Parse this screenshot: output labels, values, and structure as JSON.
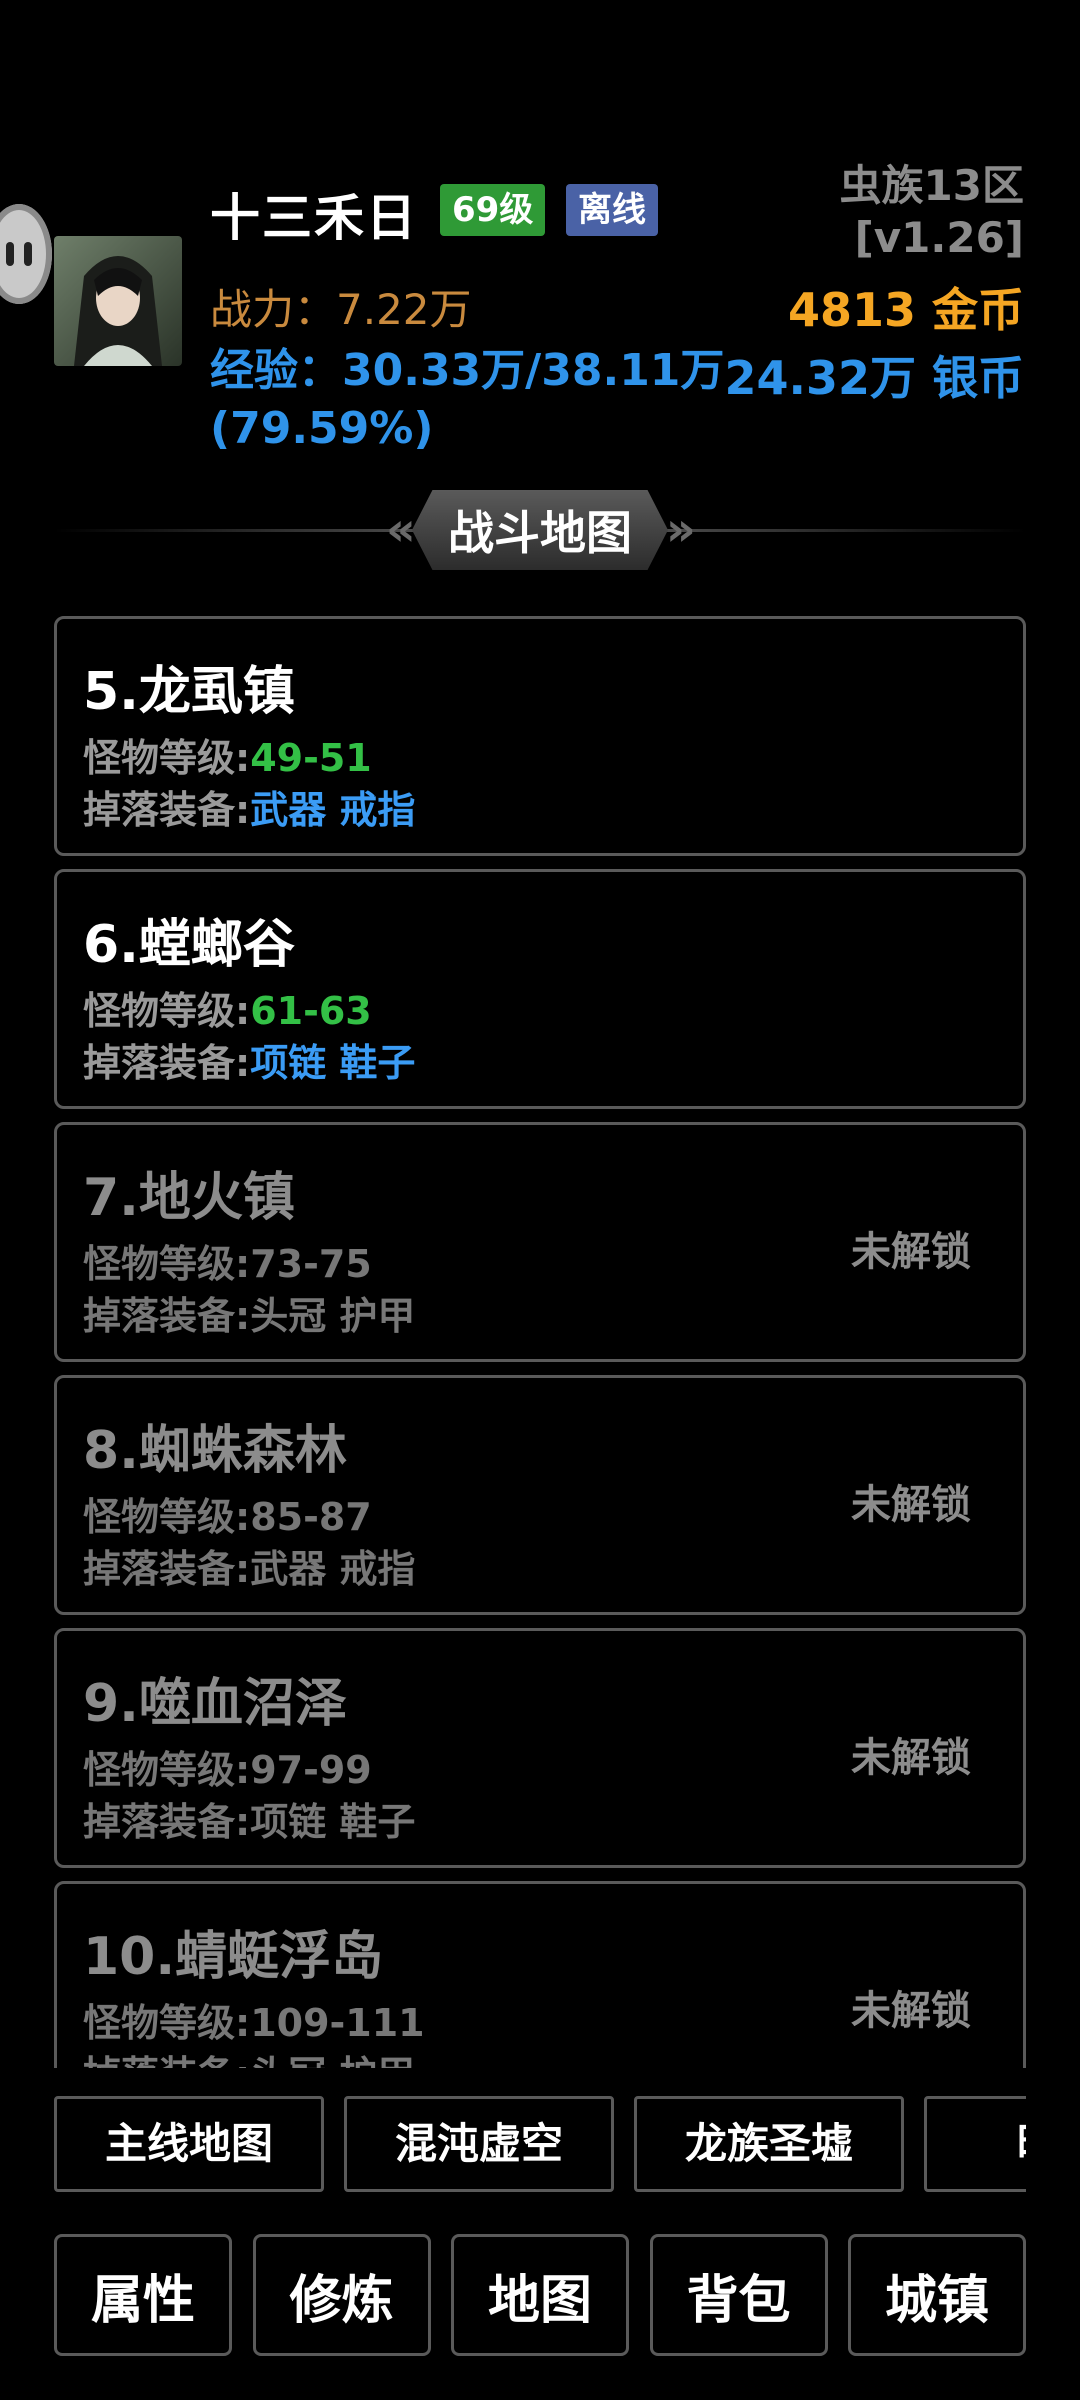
{
  "header": {
    "player_name": "十三禾日",
    "level_badge": "69级",
    "status_badge": "离线",
    "server": "虫族13区",
    "version": "[v1.26]",
    "power": "战力：7.22万",
    "gold": "4813 金币",
    "exp_line": "经验：30.33万/38.11万",
    "exp_percent": "(79.59%)",
    "silver": "24.32万 银币"
  },
  "colors": {
    "level_badge": "#2f9a36",
    "status_badge": "#4a62a6",
    "gold": "#f5a623",
    "exp": "#2f93ea",
    "power": "#c98a3e",
    "monster_level": "#33c046",
    "drop_items": "#3b9cf5"
  },
  "section_title": "战斗地图",
  "maps": [
    {
      "title": "5.龙虱镇",
      "level_label": "怪物等级:",
      "level": "49-51",
      "drop_label": "掉落装备:",
      "drops": "武器 戒指",
      "locked": false,
      "lock_text": ""
    },
    {
      "title": "6.螳螂谷",
      "level_label": "怪物等级:",
      "level": "61-63",
      "drop_label": "掉落装备:",
      "drops": "项链 鞋子",
      "locked": false,
      "lock_text": ""
    },
    {
      "title": "7.地火镇",
      "level_label": "怪物等级:",
      "level": "73-75",
      "drop_label": "掉落装备:",
      "drops": "头冠 护甲",
      "locked": true,
      "lock_text": "未解锁"
    },
    {
      "title": "8.蜘蛛森林",
      "level_label": "怪物等级:",
      "level": "85-87",
      "drop_label": "掉落装备:",
      "drops": "武器 戒指",
      "locked": true,
      "lock_text": "未解锁"
    },
    {
      "title": "9.噬血沼泽",
      "level_label": "怪物等级:",
      "level": "97-99",
      "drop_label": "掉落装备:",
      "drops": "项链 鞋子",
      "locked": true,
      "lock_text": "未解锁"
    },
    {
      "title": "10.蜻蜓浮岛",
      "level_label": "怪物等级:",
      "level": "109-111",
      "drop_label": "掉落装备:",
      "drops": "头冠 护甲",
      "locked": true,
      "lock_text": "未解锁"
    }
  ],
  "regions": [
    "主线地图",
    "混沌虚空",
    "龙族圣墟",
    "暗影"
  ],
  "nav": [
    "属性",
    "修炼",
    "地图",
    "背包",
    "城镇"
  ]
}
